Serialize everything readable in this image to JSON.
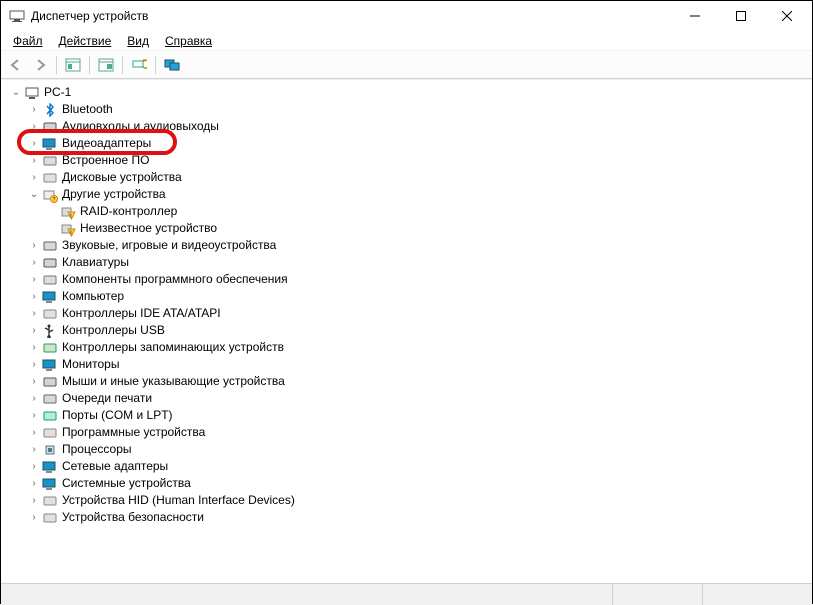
{
  "window": {
    "title": "Диспетчер устройств"
  },
  "menu": {
    "file": "Файл",
    "action": "Действие",
    "view": "Вид",
    "help": "Справка"
  },
  "toolbar": {
    "back": "back",
    "forward": "forward",
    "show_hidden": "show-hidden",
    "properties": "properties",
    "update": "update",
    "refresh": "refresh",
    "monitors": "monitors"
  },
  "tree": {
    "root": "PC-1",
    "nodes": [
      {
        "label": "Bluetooth",
        "icon": "bluetooth"
      },
      {
        "label": "Аудиовходы и аудиовыходы",
        "icon": "audio-io"
      },
      {
        "label": "Видеоадаптеры",
        "icon": "display-adapter",
        "highlighted": true
      },
      {
        "label": "Встроенное ПО",
        "icon": "firmware"
      },
      {
        "label": "Дисковые устройства",
        "icon": "disk"
      },
      {
        "label": "Другие устройства",
        "icon": "other",
        "expanded": true,
        "children": [
          {
            "label": "RAID-контроллер",
            "icon": "warning-device"
          },
          {
            "label": "Неизвестное устройство",
            "icon": "warning-device"
          }
        ]
      },
      {
        "label": "Звуковые, игровые и видеоустройства",
        "icon": "sound"
      },
      {
        "label": "Клавиатуры",
        "icon": "keyboard"
      },
      {
        "label": "Компоненты программного обеспечения",
        "icon": "software"
      },
      {
        "label": "Компьютер",
        "icon": "computer"
      },
      {
        "label": "Контроллеры IDE ATA/ATAPI",
        "icon": "ide"
      },
      {
        "label": "Контроллеры USB",
        "icon": "usb"
      },
      {
        "label": "Контроллеры запоминающих устройств",
        "icon": "storage"
      },
      {
        "label": "Мониторы",
        "icon": "monitor"
      },
      {
        "label": "Мыши и иные указывающие устройства",
        "icon": "mouse"
      },
      {
        "label": "Очереди печати",
        "icon": "print"
      },
      {
        "label": "Порты (COM и LPT)",
        "icon": "ports"
      },
      {
        "label": "Программные устройства",
        "icon": "soft-device"
      },
      {
        "label": "Процессоры",
        "icon": "cpu"
      },
      {
        "label": "Сетевые адаптеры",
        "icon": "network"
      },
      {
        "label": "Системные устройства",
        "icon": "system"
      },
      {
        "label": "Устройства HID (Human Interface Devices)",
        "icon": "hid"
      },
      {
        "label": "Устройства безопасности",
        "icon": "security"
      }
    ]
  },
  "icons": {
    "bluetooth": "#0078d7",
    "audio-io": "#555",
    "display-adapter": "#1e90c8",
    "firmware": "#777",
    "disk": "#888",
    "other": "#c8a000",
    "warning-device": "#e0a000",
    "sound": "#666",
    "keyboard": "#555",
    "software": "#777",
    "computer": "#1e90c8",
    "ide": "#888",
    "usb": "#333",
    "storage": "#2a9d4a",
    "monitor": "#1e90c8",
    "mouse": "#555",
    "print": "#666",
    "ports": "#0a6",
    "soft-device": "#888",
    "cpu": "#6a8",
    "network": "#1e90c8",
    "system": "#1e90c8",
    "hid": "#888",
    "security": "#888",
    "root": "#555"
  }
}
